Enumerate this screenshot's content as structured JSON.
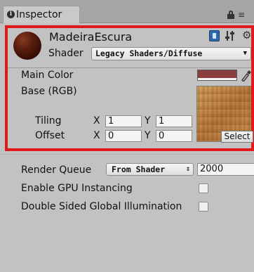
{
  "tab": {
    "title": "Inspector"
  },
  "material": {
    "name": "MadeiraEscura",
    "shader_label": "Shader",
    "shader_value": "Legacy Shaders/Diffuse",
    "sphere_color": "#5a1e0f"
  },
  "properties": {
    "main_color_label": "Main Color",
    "main_color_value": "#8a3e3e",
    "base_label": "Base (RGB)",
    "tiling_label": "Tiling",
    "offset_label": "Offset",
    "x_label": "X",
    "y_label": "Y",
    "tiling_x": "1",
    "tiling_y": "1",
    "offset_x": "0",
    "offset_y": "0",
    "select_label": "Select"
  },
  "render": {
    "render_queue_label": "Render Queue",
    "render_queue_option": "From Shader",
    "render_queue_value": "2000",
    "gpu_instancing_label": "Enable GPU Instancing",
    "double_sided_gi_label": "Double Sided Global Illumination"
  },
  "colors": {
    "highlight": "#e0191b",
    "panel_bg": "#c2c2c2"
  }
}
